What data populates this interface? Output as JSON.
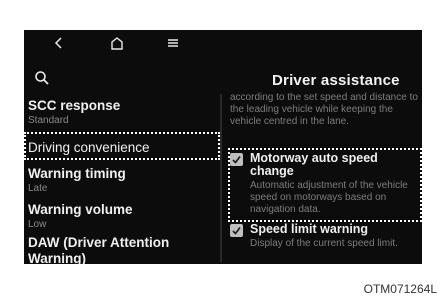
{
  "nav": {
    "back_icon": "chevron-left-icon",
    "home_icon": "home-icon",
    "menu_icon": "menu-icon"
  },
  "header": {
    "title": "Driver assistance",
    "search_icon": "search-icon"
  },
  "list": [
    {
      "label": "SCC response",
      "sub": "Standard"
    },
    {
      "label": "Driving convenience",
      "sub": ""
    },
    {
      "label": "Warning timing",
      "sub": "Late"
    },
    {
      "label": "Warning volume",
      "sub": "Low"
    },
    {
      "label": "DAW (Driver Attention Warning)",
      "sub": ""
    }
  ],
  "right": {
    "top_desc": "according to the set speed and distance to the leading vehicle while keeping the vehicle centred in the lane.",
    "options": [
      {
        "label": "Motorway auto speed change",
        "desc": "Automatic adjustment of the vehicle speed on motorways based on navigation data.",
        "checked": true
      },
      {
        "label": "Speed limit warning",
        "desc": "Display of the current speed limit.",
        "checked": true
      }
    ]
  },
  "caption": "OTM071264L"
}
